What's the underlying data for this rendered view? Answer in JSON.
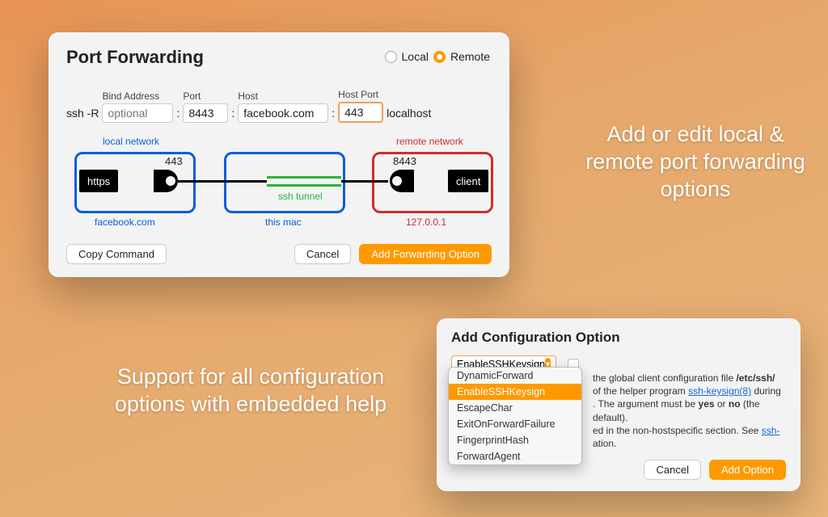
{
  "marketing": {
    "line1": "Add or edit local & remote port forwarding options",
    "line2": "Support for all configuration options with embedded help"
  },
  "port_forwarding": {
    "title": "Port Forwarding",
    "mode": {
      "local_label": "Local",
      "remote_label": "Remote",
      "selected": "Remote"
    },
    "fields": {
      "prefix": "ssh -R",
      "bind_address_label": "Bind Address",
      "bind_address_placeholder": "optional",
      "bind_address_value": "",
      "port_label": "Port",
      "port_value": "8443",
      "host_label": "Host",
      "host_value": "facebook.com",
      "host_port_label": "Host Port",
      "host_port_value": "443",
      "suffix": "localhost"
    },
    "diagram": {
      "local_network_label": "local network",
      "remote_network_label": "remote network",
      "this_mac_label": "this mac",
      "ssh_tunnel_label": "ssh tunnel",
      "left_block_label": "https",
      "left_port": "443",
      "left_host": "facebook.com",
      "right_block_label": "client",
      "right_port": "8443",
      "right_host": "127.0.0.1"
    },
    "buttons": {
      "copy": "Copy Command",
      "cancel": "Cancel",
      "add": "Add Forwarding Option"
    }
  },
  "add_config": {
    "title": "Add Configuration Option",
    "selected_option": "EnableSSHKeysign",
    "dropdown": [
      "DynamicForward",
      "EnableSSHKeysign",
      "EscapeChar",
      "ExitOnForwardFailure",
      "FingerprintHash",
      "ForwardAgent"
    ],
    "help": {
      "p1a": " the global client configuration file ",
      "p1b": "/etc/ssh/",
      "p2a": " of the helper program ",
      "p2link": "ssh-keysign(8)",
      "p2b": " during",
      "p3a": ". The argument must be ",
      "p3b": "yes",
      "p3c": " or ",
      "p3d": "no",
      "p3e": " (the default).",
      "p4a": "ed in the non-hostspecific section. See ",
      "p4link": "ssh-",
      "p5": "ation."
    },
    "buttons": {
      "cancel": "Cancel",
      "add": "Add Option"
    }
  }
}
